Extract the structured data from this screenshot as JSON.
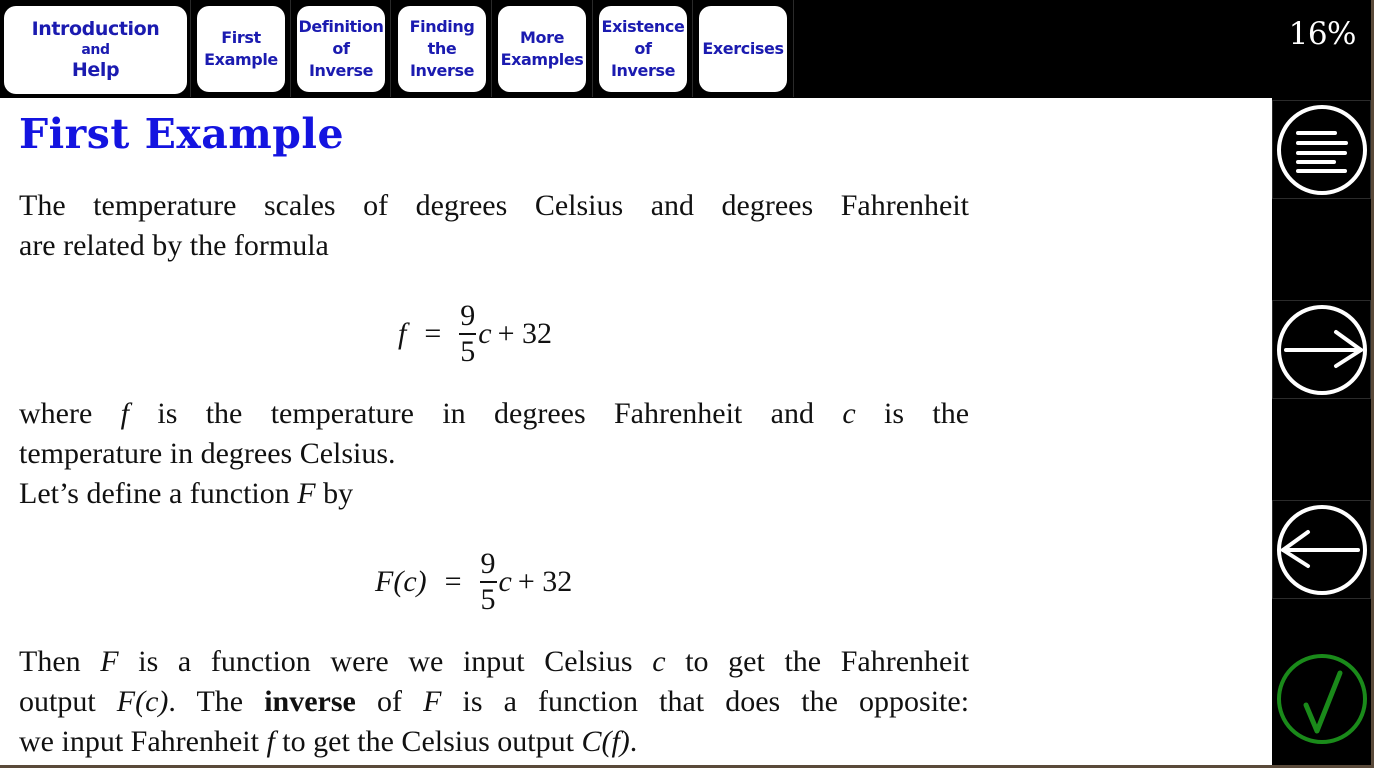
{
  "nav": {
    "tabs": [
      {
        "lines": [
          "Introduction",
          "and",
          "Help"
        ],
        "active": true
      },
      {
        "lines": [
          "First",
          "Example"
        ],
        "active": false
      },
      {
        "lines": [
          "Definition",
          "of",
          "Inverse"
        ],
        "active": false
      },
      {
        "lines": [
          "Finding",
          "the",
          "Inverse"
        ],
        "active": false
      },
      {
        "lines": [
          "More",
          "Examples"
        ],
        "active": false
      },
      {
        "lines": [
          "Existence",
          "of",
          "Inverse"
        ],
        "active": false
      },
      {
        "lines": [
          "Exercises"
        ],
        "active": false
      }
    ],
    "progress": "16%"
  },
  "page": {
    "title": "First Example",
    "para1": {
      "line1": "The temperature scales of degrees Celsius and degrees Fahrenheit",
      "line2": "are related by the formula"
    },
    "eq1": {
      "lhs": "f",
      "eq": "=",
      "num": "9",
      "den": "5",
      "var": "c",
      "rest": "+ 32"
    },
    "para2": {
      "l1_a": "where",
      "l1_f": "f",
      "l1_b": "is the temperature in degrees Fahrenheit and",
      "l1_c": "c",
      "l1_d": "is the",
      "line2": "temperature in degrees Celsius.",
      "l3_a": "Let’s define a function",
      "l3_F": "F",
      "l3_b": "by"
    },
    "eq2": {
      "lhs": "F(c)",
      "eq": "=",
      "num": "9",
      "den": "5",
      "var": "c",
      "rest": "+ 32"
    },
    "para3": {
      "l1_a": "Then",
      "l1_F": "F",
      "l1_b": "is a function were we input Celsius",
      "l1_c": "c",
      "l1_d": "to get the Fahrenheit",
      "l2_a": "output",
      "l2_Fc": "F(c)",
      "l2_b": ". The",
      "l2_bold": "inverse",
      "l2_c": "of",
      "l2_F": "F",
      "l2_d": "is a function that does the opposite:",
      "l3_a": "we input Fahrenheit",
      "l3_f": "f",
      "l3_b": "to get the Celsius output",
      "l3_Cf": "C(f)",
      "l3_c": "."
    }
  },
  "side": {
    "buttons": [
      {
        "name": "contents-menu",
        "icon": "menu-lines-icon",
        "color": "#ffffff"
      },
      {
        "name": "next-page",
        "icon": "arrow-right-icon",
        "color": "#ffffff"
      },
      {
        "name": "previous-page",
        "icon": "arrow-left-icon",
        "color": "#ffffff"
      },
      {
        "name": "done-check",
        "icon": "checkmark-icon",
        "color": "#1a8a1a"
      }
    ]
  },
  "colors": {
    "title": "#1414e0",
    "tab_text": "#1b1bb0",
    "check": "#1a8a1a"
  }
}
